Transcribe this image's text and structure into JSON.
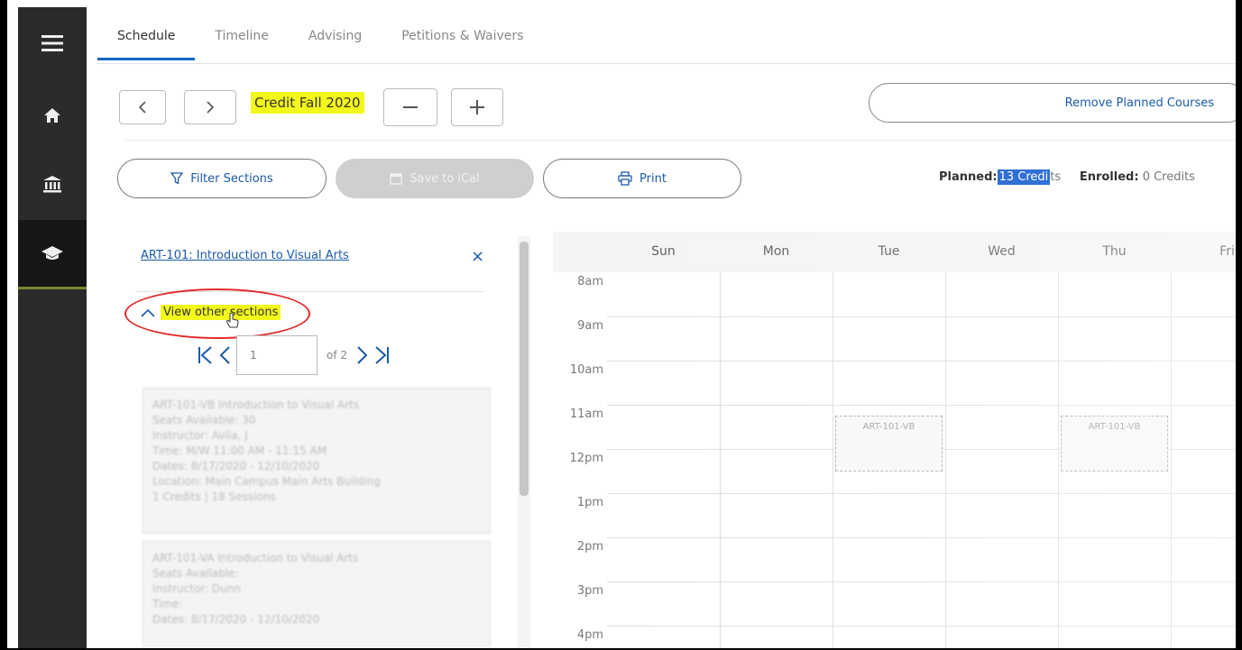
{
  "nav": {
    "items": [
      {
        "name": "menu",
        "icon": "hamburger-menu-icon"
      },
      {
        "name": "home",
        "icon": "home-icon"
      },
      {
        "name": "finance",
        "icon": "bank-icon"
      },
      {
        "name": "academics",
        "icon": "graduation-cap-icon",
        "active": true
      }
    ]
  },
  "tabs": [
    {
      "label": "Schedule",
      "active": true
    },
    {
      "label": "Timeline"
    },
    {
      "label": "Advising"
    },
    {
      "label": "Petitions & Waivers"
    }
  ],
  "term": {
    "title": "Credit Fall 2020",
    "prev_icon": "chevron-left-icon",
    "next_icon": "chevron-right-icon",
    "remove_icon": "minus-icon",
    "add_icon": "plus-icon",
    "remove_planned_label": "Remove Planned Courses"
  },
  "actions": {
    "filter_label": "Filter Sections",
    "save_label": "Save to iCal",
    "print_label": "Print"
  },
  "credits": {
    "planned_label": "Planned:",
    "planned_value": "13 Credi",
    "planned_suffix": "ts",
    "enrolled_label": "Enrolled:",
    "enrolled_value": "0 Credits"
  },
  "course": {
    "title": "ART-101: Introduction to Visual Arts",
    "close_glyph": "×",
    "view_other_label": "View other sections",
    "page_value": "1",
    "of_pages": "of 2",
    "sections": [
      {
        "lines": [
          "ART-101-VB Introduction to Visual Arts",
          "Seats Available: 30",
          "Instructor: Avila, J",
          "Time: M/W 11:00 AM - 11:15 AM",
          "Dates: 8/17/2020 - 12/10/2020",
          "Location: Main Campus Main Arts Building",
          "1 Credits | 18 Sessions"
        ]
      },
      {
        "lines": [
          "ART-101-VA Introduction to Visual Arts",
          "Seats Available:",
          "Instructor: Dunn",
          "Time:",
          "Dates: 8/17/2020 - 12/10/2020"
        ]
      }
    ]
  },
  "calendar": {
    "days": [
      "Sun",
      "Mon",
      "Tue",
      "Wed",
      "Thu",
      "Fri"
    ],
    "hours": [
      "8am",
      "9am",
      "10am",
      "11am",
      "12pm",
      "1pm",
      "2pm",
      "3pm",
      "4pm"
    ],
    "events": [
      {
        "label": "ART-101-VB",
        "day": "Tue",
        "start": "11:15",
        "end": "12:30"
      },
      {
        "label": "ART-101-VB",
        "day": "Thu",
        "start": "11:15",
        "end": "12:30"
      }
    ]
  }
}
